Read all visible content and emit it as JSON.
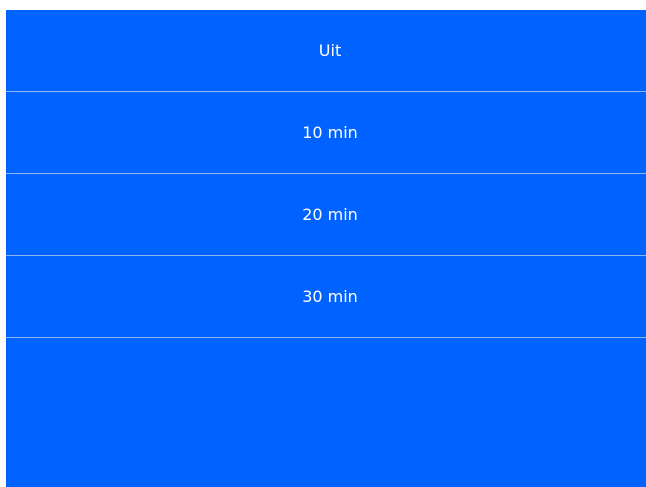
{
  "timer_menu": {
    "items": [
      {
        "label": "Uit"
      },
      {
        "label": "10 min"
      },
      {
        "label": "20 min"
      },
      {
        "label": "30 min"
      }
    ]
  },
  "colors": {
    "background": "#0062FF",
    "divider": "#8fb4f5",
    "text": "#ffffff"
  }
}
